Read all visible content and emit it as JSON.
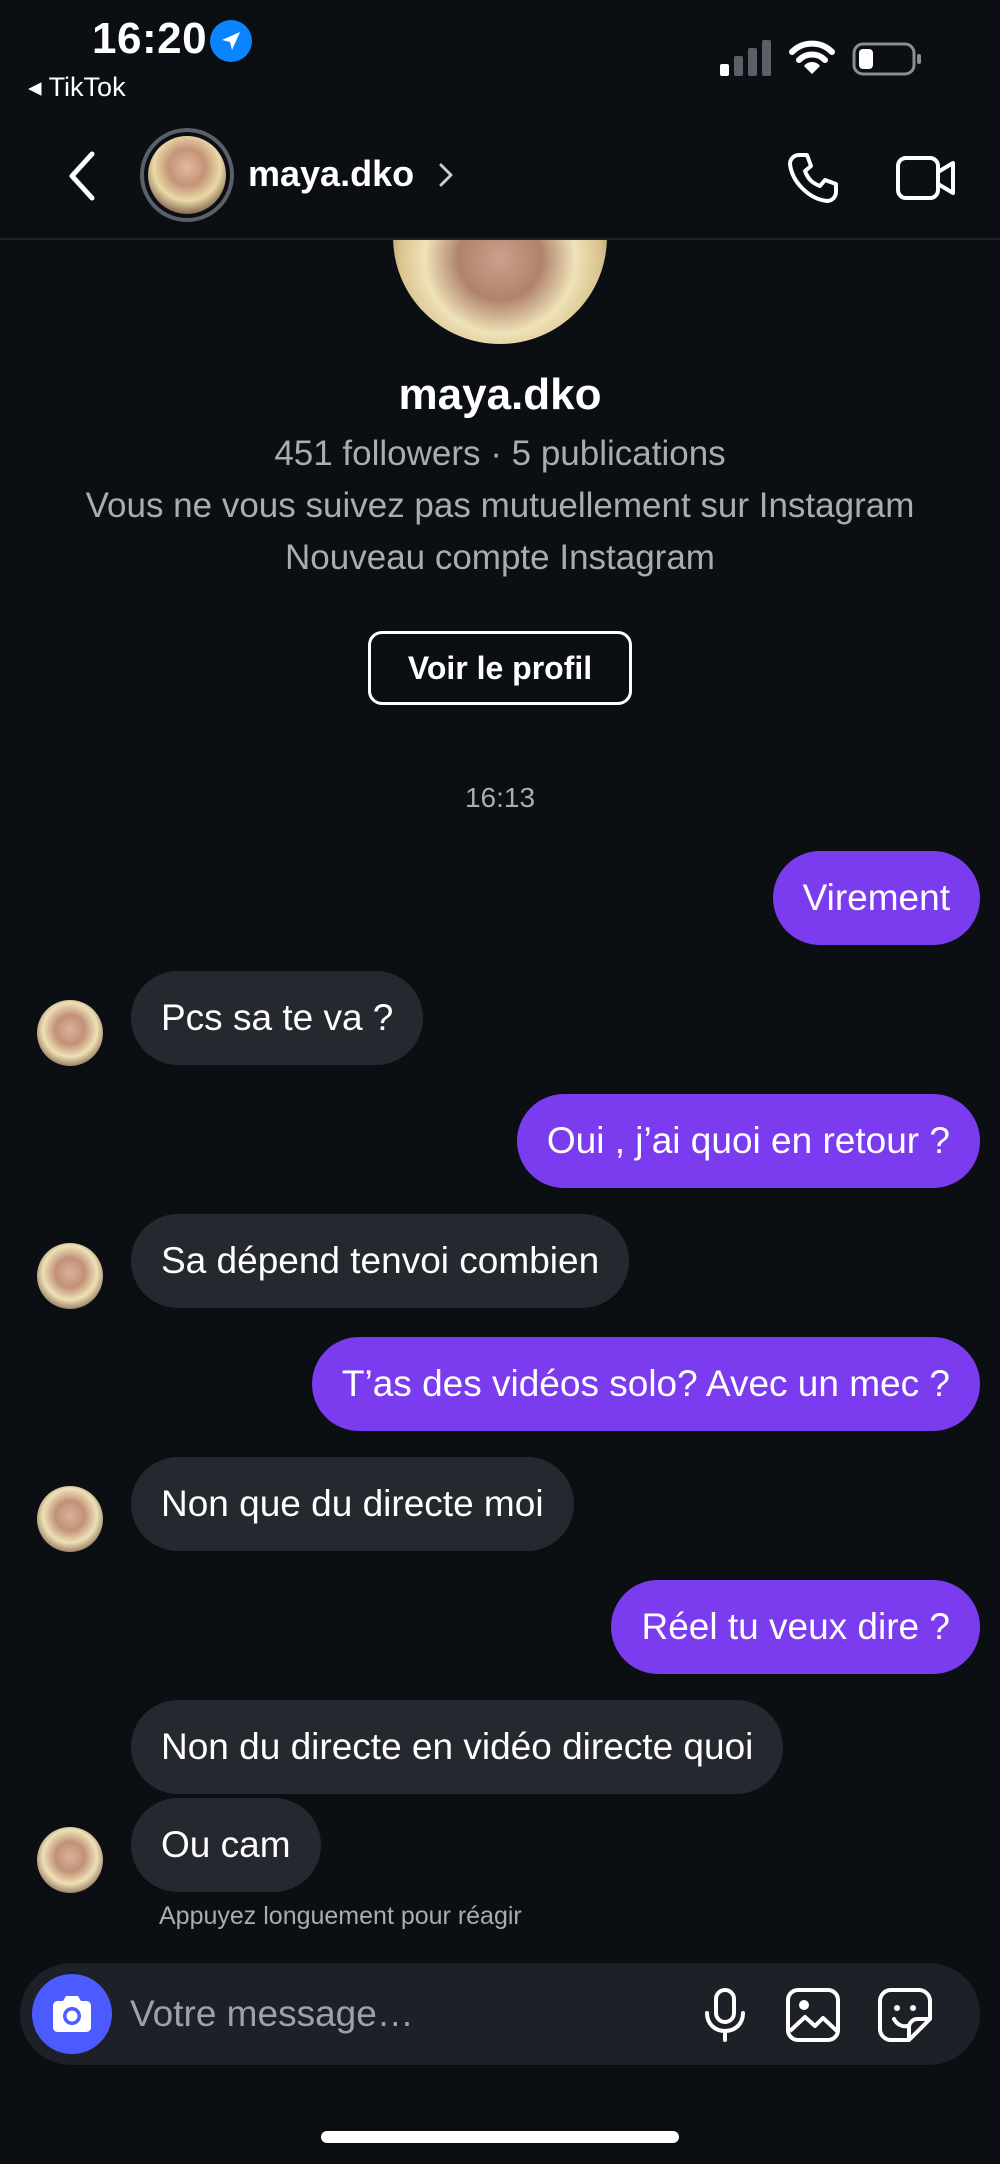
{
  "status_bar": {
    "time": "16:20",
    "back_app": "◂ TikTok",
    "location_icon": "location-arrow-icon",
    "signal_icon": "cell-signal-icon",
    "wifi_icon": "wifi-icon",
    "battery_icon": "battery-icon"
  },
  "header": {
    "username": "maya.dko",
    "back_icon": "chevron-left-icon",
    "call_icon": "phone-icon",
    "video_icon": "video-camera-icon"
  },
  "profile": {
    "name": "maya.dko",
    "stats": "451 followers · 5 publications",
    "mutual": "Vous ne vous suivez pas mutuellement sur Instagram",
    "new_account": "Nouveau compte Instagram",
    "view_profile_label": "Voir le profil"
  },
  "thread": {
    "timestamp": "16:13",
    "messages": [
      {
        "from": "me",
        "text": "Virement"
      },
      {
        "from": "them",
        "text": "Pcs sa te va ?"
      },
      {
        "from": "me",
        "text": "Oui , j’ai quoi en retour ?"
      },
      {
        "from": "them",
        "text": "Sa dépend tenvoi combien"
      },
      {
        "from": "me",
        "text": "T’as des vidéos solo? Avec un mec ?"
      },
      {
        "from": "them",
        "text": "Non que du directe moi"
      },
      {
        "from": "me",
        "text": "Réel tu veux dire ?"
      },
      {
        "from": "them",
        "text": "Non du directe en vidéo directe quoi"
      },
      {
        "from": "them",
        "text": "Ou cam"
      }
    ],
    "hint": "Appuyez longuement pour réagir"
  },
  "composer": {
    "placeholder": "Votre message…",
    "camera_icon": "camera-icon",
    "mic_icon": "microphone-icon",
    "gallery_icon": "image-icon",
    "sticker_icon": "sticker-icon"
  },
  "colors": {
    "background": "#0b0e13",
    "outgoing_bubble": "#7b3cf0",
    "incoming_bubble": "#25282e",
    "camera_button": "#4c5bff",
    "secondary_text": "#a8acb3"
  }
}
